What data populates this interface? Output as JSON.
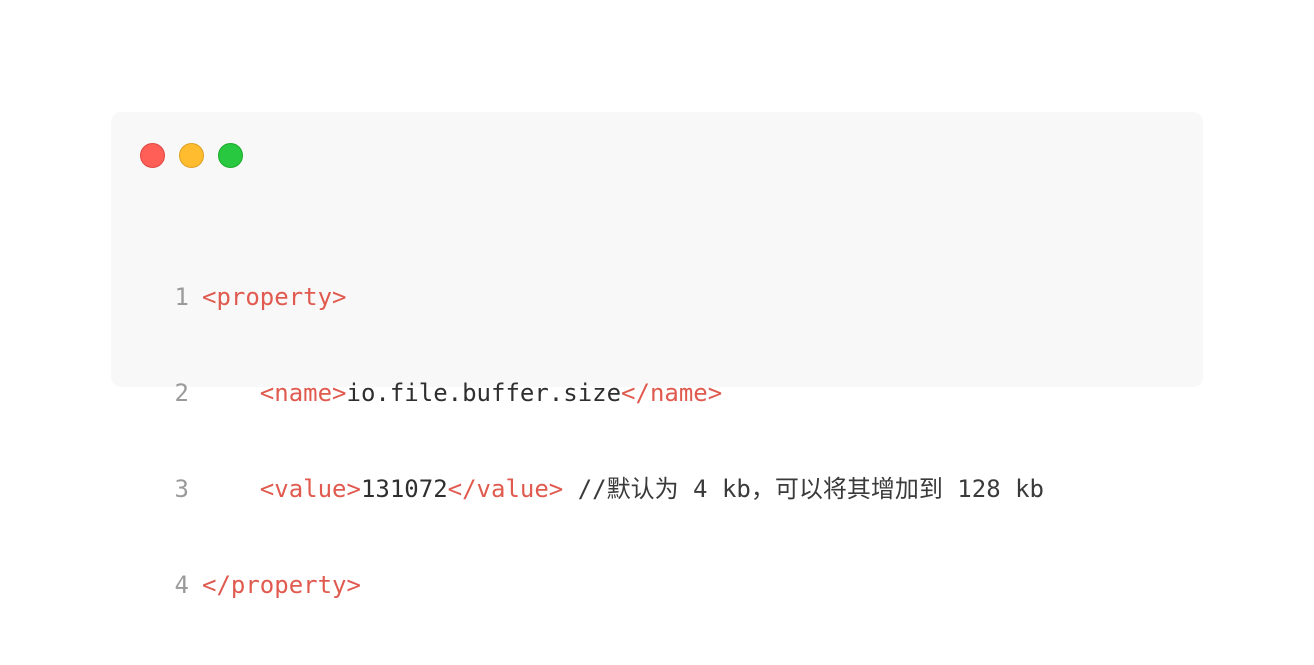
{
  "window": {
    "controls": [
      "close",
      "minimize",
      "maximize"
    ],
    "colors": {
      "close": "#ff5f57",
      "minimize": "#febc2e",
      "maximize": "#28c840",
      "tag": "#e05a4f",
      "text": "#2f2f2f",
      "line_number": "#9a9a9a",
      "background": "#f8f8f8"
    }
  },
  "code": {
    "lines": [
      {
        "number": "1",
        "indent": "",
        "open_tag": "<property>",
        "text": "",
        "close_tag": "",
        "comment": ""
      },
      {
        "number": "2",
        "indent": "    ",
        "open_tag": "<name>",
        "text": "io.file.buffer.size",
        "close_tag": "</name>",
        "comment": ""
      },
      {
        "number": "3",
        "indent": "    ",
        "open_tag": "<value>",
        "text": "131072",
        "close_tag": "</value>",
        "comment": " //默认为 4 kb，可以将其增加到 128 kb"
      },
      {
        "number": "4",
        "indent": "",
        "open_tag": "</property>",
        "text": "",
        "close_tag": "",
        "comment": ""
      }
    ]
  }
}
